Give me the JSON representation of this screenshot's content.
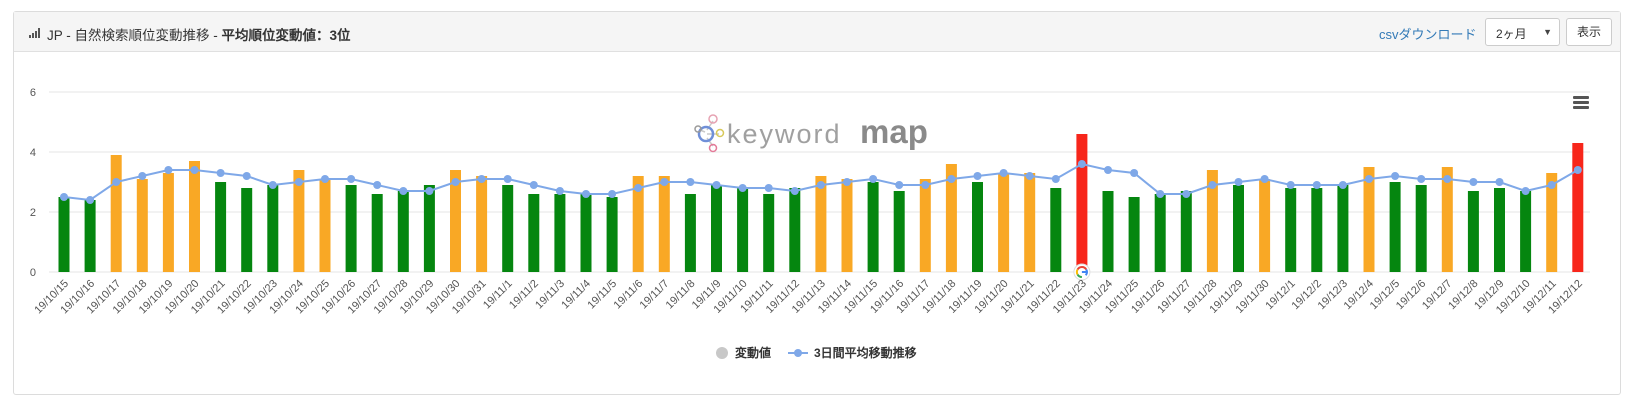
{
  "header": {
    "title_prefix": "JP - 自然検索順位変動推移 - ",
    "title_bold": "平均順位変動値：3位",
    "csv_label": "csvダウンロード",
    "period_value": "2ヶ月",
    "show_label": "表示"
  },
  "logo": {
    "text_light": "keyword",
    "text_bold": "map"
  },
  "colors": {
    "green": "#05860f",
    "orange": "#f9a825",
    "red": "#f7261b",
    "line": "#7fa8e8",
    "legend_grey": "#c8c8c8",
    "grid": "#e6e6e6"
  },
  "chart_data": {
    "type": "bar",
    "ylim": [
      0,
      6
    ],
    "yticks": [
      0,
      2,
      4,
      6
    ],
    "categories": [
      "19/10/15",
      "19/10/16",
      "19/10/17",
      "19/10/18",
      "19/10/19",
      "19/10/20",
      "19/10/21",
      "19/10/22",
      "19/10/23",
      "19/10/24",
      "19/10/25",
      "19/10/26",
      "19/10/27",
      "19/10/28",
      "19/10/29",
      "19/10/30",
      "19/10/31",
      "19/11/1",
      "19/11/2",
      "19/11/3",
      "19/11/4",
      "19/11/5",
      "19/11/6",
      "19/11/7",
      "19/11/8",
      "19/11/9",
      "19/11/10",
      "19/11/11",
      "19/11/12",
      "19/11/13",
      "19/11/14",
      "19/11/15",
      "19/11/16",
      "19/11/17",
      "19/11/18",
      "19/11/19",
      "19/11/20",
      "19/11/21",
      "19/11/22",
      "19/11/23",
      "19/11/24",
      "19/11/25",
      "19/11/26",
      "19/11/27",
      "19/11/28",
      "19/11/29",
      "19/11/30",
      "19/12/1",
      "19/12/2",
      "19/12/3",
      "19/12/4",
      "19/12/5",
      "19/12/6",
      "19/12/7",
      "19/12/8",
      "19/12/9",
      "19/12/10",
      "19/12/11",
      "19/12/12"
    ],
    "series": [
      {
        "name": "変動値",
        "type": "bar",
        "values": [
          2.5,
          2.4,
          3.9,
          3.1,
          3.3,
          3.7,
          3.0,
          2.8,
          2.9,
          3.4,
          3.1,
          2.9,
          2.6,
          2.7,
          2.9,
          3.4,
          3.2,
          2.9,
          2.6,
          2.6,
          2.6,
          2.5,
          3.2,
          3.2,
          2.6,
          2.9,
          2.8,
          2.6,
          2.8,
          3.2,
          3.1,
          3.0,
          2.7,
          3.1,
          3.6,
          3.0,
          3.3,
          3.3,
          2.8,
          4.6,
          2.7,
          2.5,
          2.6,
          2.7,
          3.4,
          2.9,
          3.1,
          2.8,
          2.8,
          2.9,
          3.5,
          3.0,
          2.9,
          3.5,
          2.7,
          2.8,
          2.7,
          3.3,
          4.3
        ],
        "color_levels": [
          "green",
          "green",
          "orange",
          "orange",
          "orange",
          "orange",
          "green",
          "green",
          "green",
          "orange",
          "orange",
          "green",
          "green",
          "green",
          "green",
          "orange",
          "orange",
          "green",
          "green",
          "green",
          "green",
          "green",
          "orange",
          "orange",
          "green",
          "green",
          "green",
          "green",
          "green",
          "orange",
          "orange",
          "green",
          "green",
          "orange",
          "orange",
          "green",
          "orange",
          "orange",
          "green",
          "red",
          "green",
          "green",
          "green",
          "green",
          "orange",
          "green",
          "orange",
          "green",
          "green",
          "green",
          "orange",
          "green",
          "green",
          "orange",
          "green",
          "green",
          "green",
          "orange",
          "red"
        ]
      },
      {
        "name": "3日間平均移動推移",
        "type": "line",
        "values": [
          2.5,
          2.4,
          3.0,
          3.2,
          3.4,
          3.4,
          3.3,
          3.2,
          2.9,
          3.0,
          3.1,
          3.1,
          2.9,
          2.7,
          2.7,
          3.0,
          3.1,
          3.1,
          2.9,
          2.7,
          2.6,
          2.6,
          2.8,
          3.0,
          3.0,
          2.9,
          2.8,
          2.8,
          2.7,
          2.9,
          3.0,
          3.1,
          2.9,
          2.9,
          3.1,
          3.2,
          3.3,
          3.2,
          3.1,
          3.6,
          3.4,
          3.3,
          2.6,
          2.6,
          2.9,
          3.0,
          3.1,
          2.9,
          2.9,
          2.9,
          3.1,
          3.2,
          3.1,
          3.1,
          3.0,
          3.0,
          2.7,
          2.9,
          3.4
        ]
      }
    ],
    "google_marker_category": "19/11/23",
    "legend_placement": "bottom-center"
  }
}
